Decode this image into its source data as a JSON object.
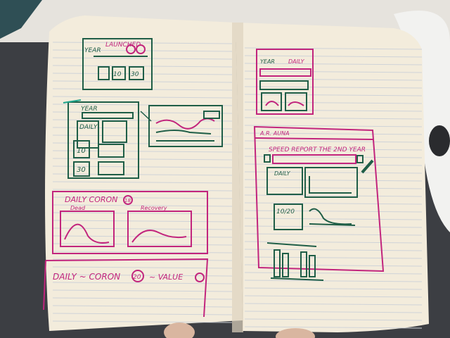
{
  "colors": {
    "background": "#3c3e43",
    "paper": "#f3ecdc",
    "paper_shadow": "#ddd3bd",
    "ruled_line": "#cfd3d8",
    "ink_green": "#1f5e47",
    "ink_teal": "#1fa58c",
    "ink_magenta": "#c2257d"
  },
  "left_page": {
    "sketch_top": {
      "header_label": "LAUNCHED",
      "year_label": "YEAR",
      "tile_1": "10",
      "tile_2": "30"
    },
    "sketch_mid": {
      "year_label": "YEAR",
      "daily_label": "DAILY",
      "tile_1": "10",
      "tile_2": "30"
    },
    "sketch_daily_corona": {
      "title": "DAILY CORON",
      "badge": "18",
      "label_left": "Dead",
      "label_right": "Recovery"
    },
    "sketch_bottom": {
      "title": "DAILY ~ CORON",
      "badge": "20",
      "suffix": "~ VALUE"
    }
  },
  "right_page": {
    "sketch_top": {
      "year_label": "YEAR",
      "daily_label": "DAILY"
    },
    "sketch_main": {
      "heading": "A.R. AUNA",
      "instruction": "SPEED REPORT THE 2ND YEAR",
      "daily_label": "DAILY",
      "tile_value": "10/20"
    }
  }
}
